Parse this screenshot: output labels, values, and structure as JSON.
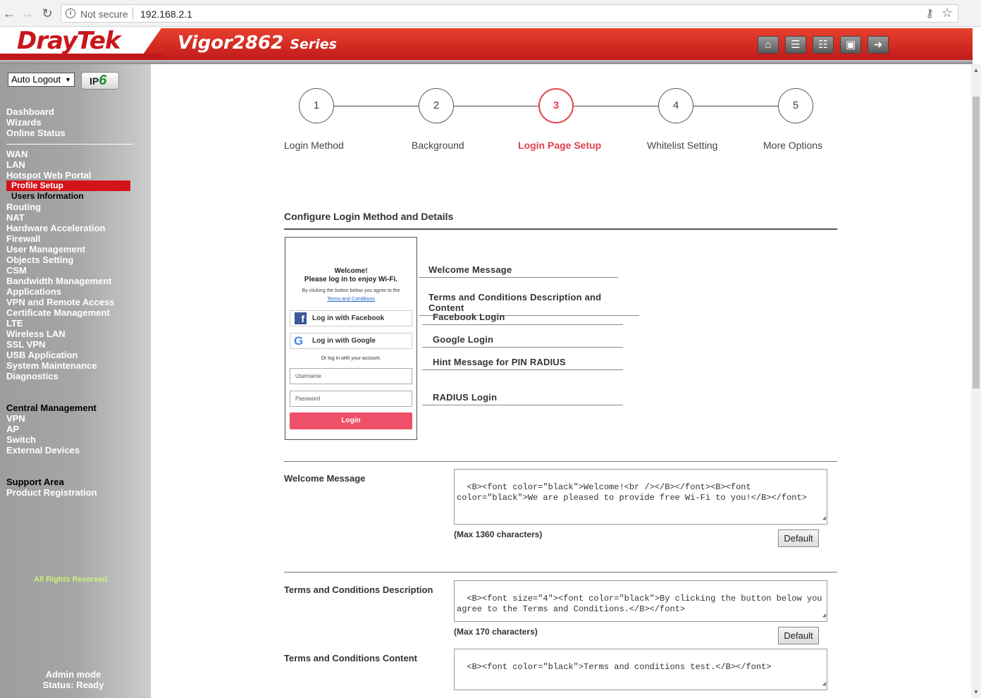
{
  "browser": {
    "security_label": "Not secure",
    "url": "192.168.2.1"
  },
  "header": {
    "brand": "DrayTek",
    "model": "Vigor2862",
    "series": "Series",
    "icons": [
      "home-icon",
      "list-icon",
      "sliders-icon",
      "save-icon",
      "logout-icon"
    ]
  },
  "sidebar": {
    "auto_logout": "Auto Logout",
    "ipv6_prefix": "IP",
    "ipv6_suffix": "6",
    "group1": [
      "Dashboard",
      "Wizards",
      "Online Status"
    ],
    "group2a": [
      "WAN",
      "LAN",
      "Hotspot Web Portal"
    ],
    "active_sub": "Profile Setup",
    "sub2": "Users Information",
    "group2b": [
      "Routing",
      "NAT",
      "Hardware Acceleration",
      "Firewall",
      "User Management",
      "Objects Setting",
      "CSM",
      "Bandwidth Management",
      "Applications",
      "VPN and Remote Access",
      "Certificate Management",
      "LTE",
      "Wireless LAN",
      "SSL VPN",
      "USB Application",
      "System Maintenance",
      "Diagnostics"
    ],
    "group3": [
      "Central Management",
      "VPN",
      "AP",
      "Switch",
      "External Devices"
    ],
    "group4": [
      "Support Area",
      "Product Registration"
    ],
    "rights": "All Rights Reserved.",
    "admin_mode": "Admin mode",
    "status": "Status: Ready"
  },
  "wizard": {
    "steps": [
      {
        "num": "1",
        "label": "Login Method"
      },
      {
        "num": "2",
        "label": "Background"
      },
      {
        "num": "3",
        "label": "Login Page Setup"
      },
      {
        "num": "4",
        "label": "Whitelist Setting"
      },
      {
        "num": "5",
        "label": "More Options"
      }
    ],
    "active_step": 3
  },
  "configure_title": "Configure Login Method and Details",
  "preview": {
    "welcome": "Welcome!",
    "welcome_sub": "Please log in to enjoy Wi-Fi.",
    "agree": "By clicking the button below you agree to the",
    "terms_link": "Terms and Conditions",
    "facebook": "Log in with Facebook",
    "google": "Log in with Google",
    "or_text": "Or log in with your account.",
    "username": "Username",
    "password": "Password",
    "login": "Login"
  },
  "links": {
    "welcome": "Welcome Message",
    "terms": "Terms and Conditions Description and Content",
    "facebook": "Facebook Login",
    "google": "Google Login",
    "hint": "Hint Message for PIN RADIUS",
    "radius": "RADIUS Login"
  },
  "fields": {
    "welcome_label": "Welcome Message",
    "welcome_value": "<B><font color=\"black\">Welcome!<br /></B></font><B><font color=\"black\">We are pleased to provide free Wi-Fi to you!</B></font>",
    "welcome_max": "(Max 1360 characters)",
    "terms_desc_label": "Terms and Conditions Description",
    "terms_desc_value": "<B><font size=\"4\"><font color=\"black\">By clicking the button below you agree to the Terms and Conditions.</B></font>",
    "terms_desc_max": "(Max 170 characters)",
    "terms_content_label": "Terms and Conditions Content",
    "terms_content_value": "<B><font color=\"black\">Terms and conditions test.</B></font>",
    "default_label": "Default"
  }
}
